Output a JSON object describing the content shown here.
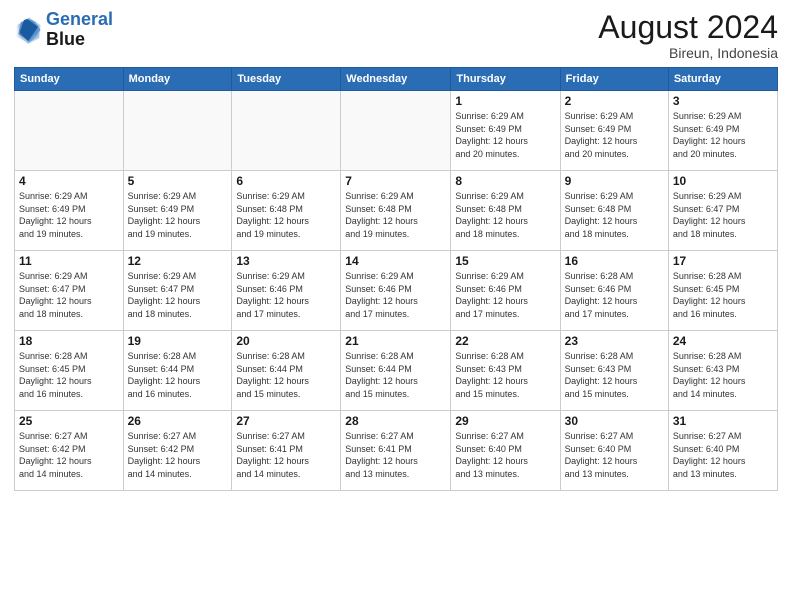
{
  "header": {
    "logo_line1": "General",
    "logo_line2": "Blue",
    "main_title": "August 2024",
    "subtitle": "Bireun, Indonesia"
  },
  "days_of_week": [
    "Sunday",
    "Monday",
    "Tuesday",
    "Wednesday",
    "Thursday",
    "Friday",
    "Saturday"
  ],
  "weeks": [
    [
      {
        "day": "",
        "info": ""
      },
      {
        "day": "",
        "info": ""
      },
      {
        "day": "",
        "info": ""
      },
      {
        "day": "",
        "info": ""
      },
      {
        "day": "1",
        "info": "Sunrise: 6:29 AM\nSunset: 6:49 PM\nDaylight: 12 hours\nand 20 minutes."
      },
      {
        "day": "2",
        "info": "Sunrise: 6:29 AM\nSunset: 6:49 PM\nDaylight: 12 hours\nand 20 minutes."
      },
      {
        "day": "3",
        "info": "Sunrise: 6:29 AM\nSunset: 6:49 PM\nDaylight: 12 hours\nand 20 minutes."
      }
    ],
    [
      {
        "day": "4",
        "info": "Sunrise: 6:29 AM\nSunset: 6:49 PM\nDaylight: 12 hours\nand 19 minutes."
      },
      {
        "day": "5",
        "info": "Sunrise: 6:29 AM\nSunset: 6:49 PM\nDaylight: 12 hours\nand 19 minutes."
      },
      {
        "day": "6",
        "info": "Sunrise: 6:29 AM\nSunset: 6:48 PM\nDaylight: 12 hours\nand 19 minutes."
      },
      {
        "day": "7",
        "info": "Sunrise: 6:29 AM\nSunset: 6:48 PM\nDaylight: 12 hours\nand 19 minutes."
      },
      {
        "day": "8",
        "info": "Sunrise: 6:29 AM\nSunset: 6:48 PM\nDaylight: 12 hours\nand 18 minutes."
      },
      {
        "day": "9",
        "info": "Sunrise: 6:29 AM\nSunset: 6:48 PM\nDaylight: 12 hours\nand 18 minutes."
      },
      {
        "day": "10",
        "info": "Sunrise: 6:29 AM\nSunset: 6:47 PM\nDaylight: 12 hours\nand 18 minutes."
      }
    ],
    [
      {
        "day": "11",
        "info": "Sunrise: 6:29 AM\nSunset: 6:47 PM\nDaylight: 12 hours\nand 18 minutes."
      },
      {
        "day": "12",
        "info": "Sunrise: 6:29 AM\nSunset: 6:47 PM\nDaylight: 12 hours\nand 18 minutes."
      },
      {
        "day": "13",
        "info": "Sunrise: 6:29 AM\nSunset: 6:46 PM\nDaylight: 12 hours\nand 17 minutes."
      },
      {
        "day": "14",
        "info": "Sunrise: 6:29 AM\nSunset: 6:46 PM\nDaylight: 12 hours\nand 17 minutes."
      },
      {
        "day": "15",
        "info": "Sunrise: 6:29 AM\nSunset: 6:46 PM\nDaylight: 12 hours\nand 17 minutes."
      },
      {
        "day": "16",
        "info": "Sunrise: 6:28 AM\nSunset: 6:46 PM\nDaylight: 12 hours\nand 17 minutes."
      },
      {
        "day": "17",
        "info": "Sunrise: 6:28 AM\nSunset: 6:45 PM\nDaylight: 12 hours\nand 16 minutes."
      }
    ],
    [
      {
        "day": "18",
        "info": "Sunrise: 6:28 AM\nSunset: 6:45 PM\nDaylight: 12 hours\nand 16 minutes."
      },
      {
        "day": "19",
        "info": "Sunrise: 6:28 AM\nSunset: 6:44 PM\nDaylight: 12 hours\nand 16 minutes."
      },
      {
        "day": "20",
        "info": "Sunrise: 6:28 AM\nSunset: 6:44 PM\nDaylight: 12 hours\nand 15 minutes."
      },
      {
        "day": "21",
        "info": "Sunrise: 6:28 AM\nSunset: 6:44 PM\nDaylight: 12 hours\nand 15 minutes."
      },
      {
        "day": "22",
        "info": "Sunrise: 6:28 AM\nSunset: 6:43 PM\nDaylight: 12 hours\nand 15 minutes."
      },
      {
        "day": "23",
        "info": "Sunrise: 6:28 AM\nSunset: 6:43 PM\nDaylight: 12 hours\nand 15 minutes."
      },
      {
        "day": "24",
        "info": "Sunrise: 6:28 AM\nSunset: 6:43 PM\nDaylight: 12 hours\nand 14 minutes."
      }
    ],
    [
      {
        "day": "25",
        "info": "Sunrise: 6:27 AM\nSunset: 6:42 PM\nDaylight: 12 hours\nand 14 minutes."
      },
      {
        "day": "26",
        "info": "Sunrise: 6:27 AM\nSunset: 6:42 PM\nDaylight: 12 hours\nand 14 minutes."
      },
      {
        "day": "27",
        "info": "Sunrise: 6:27 AM\nSunset: 6:41 PM\nDaylight: 12 hours\nand 14 minutes."
      },
      {
        "day": "28",
        "info": "Sunrise: 6:27 AM\nSunset: 6:41 PM\nDaylight: 12 hours\nand 13 minutes."
      },
      {
        "day": "29",
        "info": "Sunrise: 6:27 AM\nSunset: 6:40 PM\nDaylight: 12 hours\nand 13 minutes."
      },
      {
        "day": "30",
        "info": "Sunrise: 6:27 AM\nSunset: 6:40 PM\nDaylight: 12 hours\nand 13 minutes."
      },
      {
        "day": "31",
        "info": "Sunrise: 6:27 AM\nSunset: 6:40 PM\nDaylight: 12 hours\nand 13 minutes."
      }
    ]
  ]
}
